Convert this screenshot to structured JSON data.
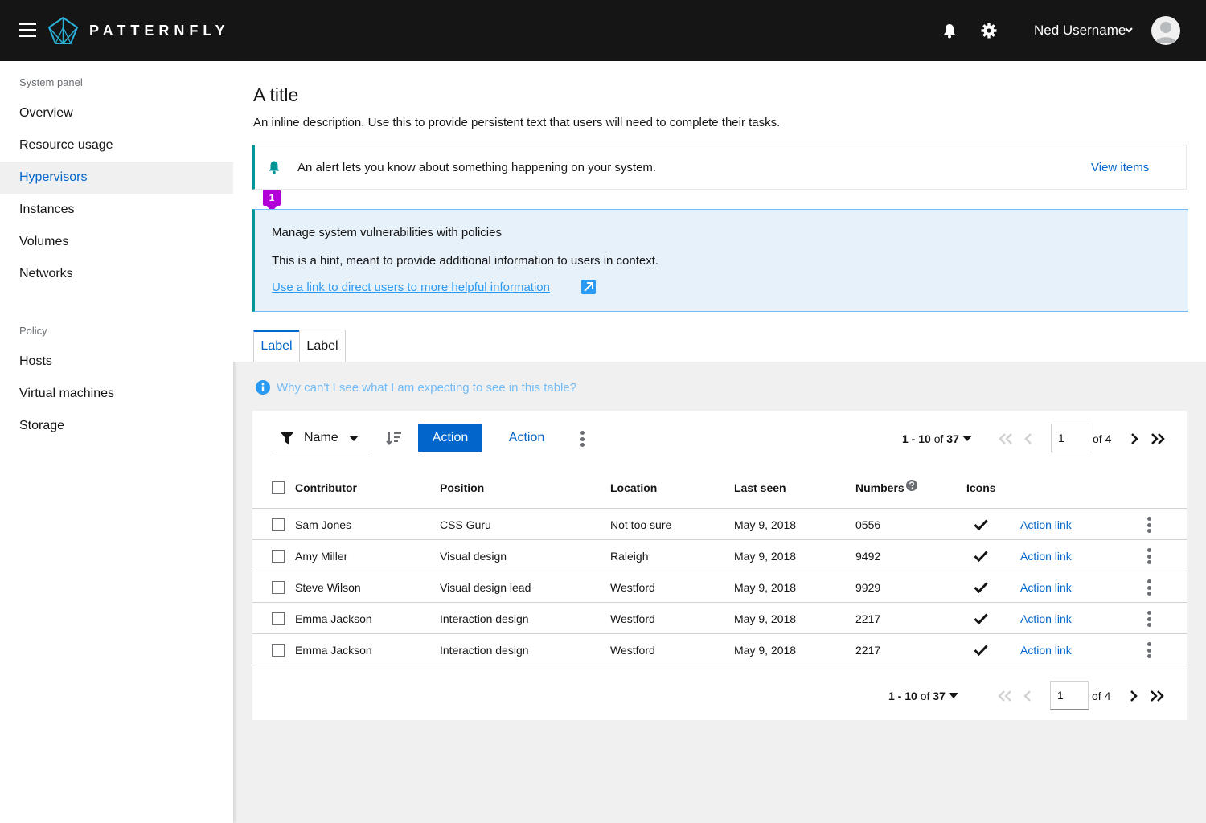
{
  "masthead": {
    "brand": "PATTERNFLY",
    "user_name": "Ned Username"
  },
  "sidebar": {
    "sections": [
      {
        "title": "System panel",
        "items": [
          "Overview",
          "Resource usage",
          "Hypervisors",
          "Instances",
          "Volumes",
          "Networks"
        ]
      },
      {
        "title": "Policy",
        "items": [
          "Hosts",
          "Virtual machines",
          "Storage"
        ]
      }
    ],
    "active_item": "Hypervisors"
  },
  "page": {
    "title": "A title",
    "description": "An inline description. Use this to provide persistent text that users will need to complete their tasks."
  },
  "alert": {
    "text": "An alert lets you know about something happening on your system.",
    "link": "View items"
  },
  "annotation_badge": "1",
  "hint": {
    "title": "Manage system vulnerabilities with policies",
    "body": "This is a hint, meant to provide additional information to users in context.",
    "link": "Use a link to direct users to more helpful information"
  },
  "tabs": [
    "Label",
    "Label"
  ],
  "help_text": "Why can't I see what I am expecting to see in this table?",
  "toolbar": {
    "filter_label": "Name",
    "primary_action": "Action",
    "secondary_action": "Action"
  },
  "pagination": {
    "range": "1 - 10",
    "of_word": "of",
    "total": "37",
    "page": "1",
    "pages_label": "of 4"
  },
  "table": {
    "columns": [
      "Contributor",
      "Position",
      "Location",
      "Last seen",
      "Numbers",
      "Icons"
    ],
    "action_label": "Action link",
    "rows": [
      [
        "Sam Jones",
        "CSS Guru",
        "Not too sure",
        "May 9, 2018",
        "0556"
      ],
      [
        "Amy Miller",
        "Visual design",
        "Raleigh",
        "May 9, 2018",
        "9492"
      ],
      [
        "Steve Wilson",
        "Visual design lead",
        "Westford",
        "May 9, 2018",
        "9929"
      ],
      [
        "Emma Jackson",
        "Interaction design",
        "Westford",
        "May 9, 2018",
        "2217"
      ],
      [
        "Emma Jackson",
        "Interaction design",
        "Westford",
        "May 9, 2018",
        "2217"
      ]
    ]
  },
  "colors": {
    "masthead": "#151515",
    "link": "#0066cc",
    "alert_accent": "#009596",
    "hint_bg": "#e7f1fa",
    "badge": "#b300d9"
  },
  "icons": [
    "hamburger-icon",
    "patternfly-logo-icon",
    "bell-icon",
    "gear-icon",
    "chevron-down-icon",
    "avatar-icon",
    "external-link-icon",
    "info-icon",
    "filter-icon",
    "sort-icon",
    "kebab-icon",
    "double-chevron-left-icon",
    "chevron-left-icon",
    "chevron-right-icon",
    "double-chevron-right-icon",
    "question-circle-icon",
    "check-icon"
  ]
}
